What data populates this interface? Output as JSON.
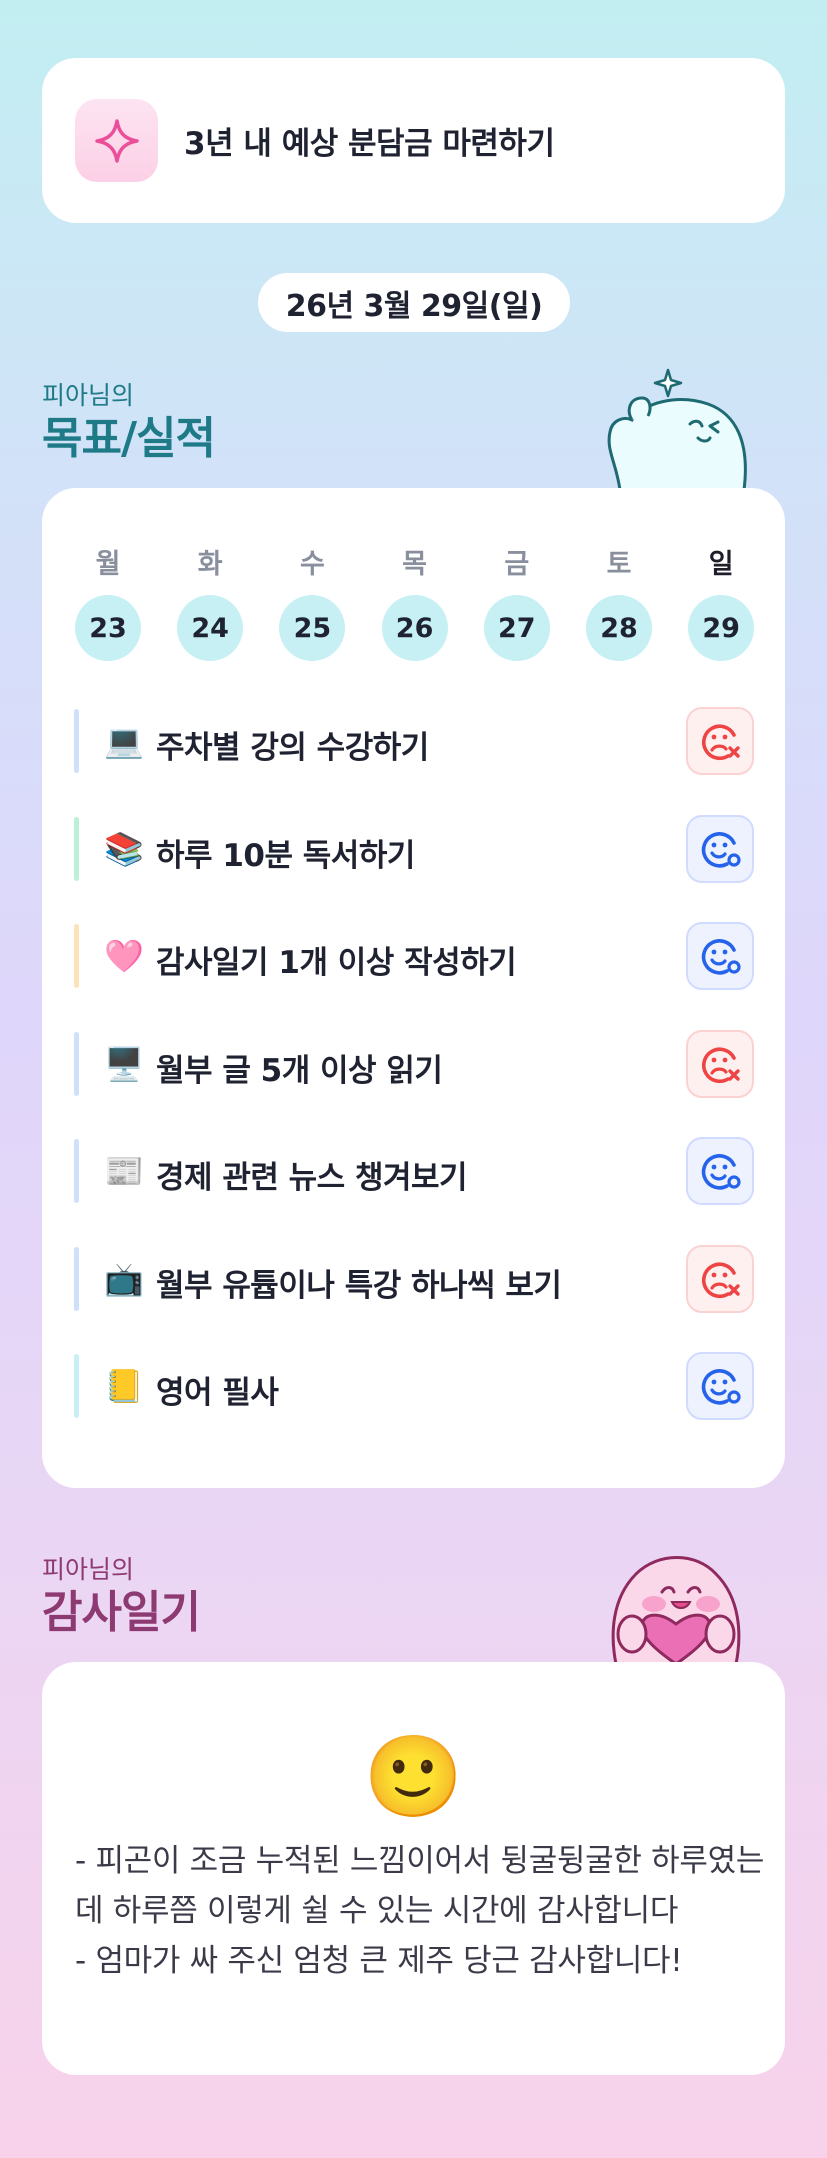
{
  "goal": {
    "title": "3년 내 예상 분담금 마련하기",
    "icon": "sparkle-icon"
  },
  "date_label": "26년 3월 29일(일)",
  "tracker_section": {
    "owner": "피아님의",
    "title": "목표/실적"
  },
  "week": {
    "days": [
      {
        "label": "월",
        "date": "23"
      },
      {
        "label": "화",
        "date": "24"
      },
      {
        "label": "수",
        "date": "25"
      },
      {
        "label": "목",
        "date": "26"
      },
      {
        "label": "금",
        "date": "27"
      },
      {
        "label": "토",
        "date": "28"
      },
      {
        "label": "일",
        "date": "29"
      }
    ],
    "today_index": 6
  },
  "tasks": [
    {
      "emoji": "💻",
      "text": "주차별 강의 수강하기",
      "status": "fail",
      "bar_color": "#cfe0fb"
    },
    {
      "emoji": "📚",
      "text": "하루 10분 독서하기",
      "status": "done",
      "bar_color": "#bdf0d8"
    },
    {
      "emoji": "🩷",
      "text": "감사일기 1개 이상 작성하기",
      "status": "done",
      "bar_color": "#fde3b8"
    },
    {
      "emoji": "🖥️",
      "text": "월부 글 5개 이상 읽기",
      "status": "fail",
      "bar_color": "#cfe0fb"
    },
    {
      "emoji": "📰",
      "text": "경제 관련 뉴스 챙겨보기",
      "status": "done",
      "bar_color": "#cfe0fb"
    },
    {
      "emoji": "📺",
      "text": "월부 유튭이나 특강 하나씩 보기",
      "status": "fail",
      "bar_color": "#cfe0fb"
    },
    {
      "emoji": "📒",
      "text": "영어 필사",
      "status": "done",
      "bar_color": "#c7f0f4"
    }
  ],
  "gratitude_section": {
    "owner": "피아님의",
    "title": "감사일기"
  },
  "gratitude": {
    "mood_emoji": "🙂",
    "text": "- 피곤이 조금 누적된 느낌이어서 뒹굴뒹굴한 하루였는데 하루쯤 이렇게 쉴 수 있는 시간에 감사합니다\n- 엄마가 싸 주신 엄청 큰 제주 당근 감사합니다!"
  },
  "colors": {
    "teal_heading": "#1e7a86",
    "plum_heading": "#8e3a72",
    "status_fail": "#ef4444",
    "status_done": "#2563eb",
    "date_circle": "#c7f0f4"
  }
}
